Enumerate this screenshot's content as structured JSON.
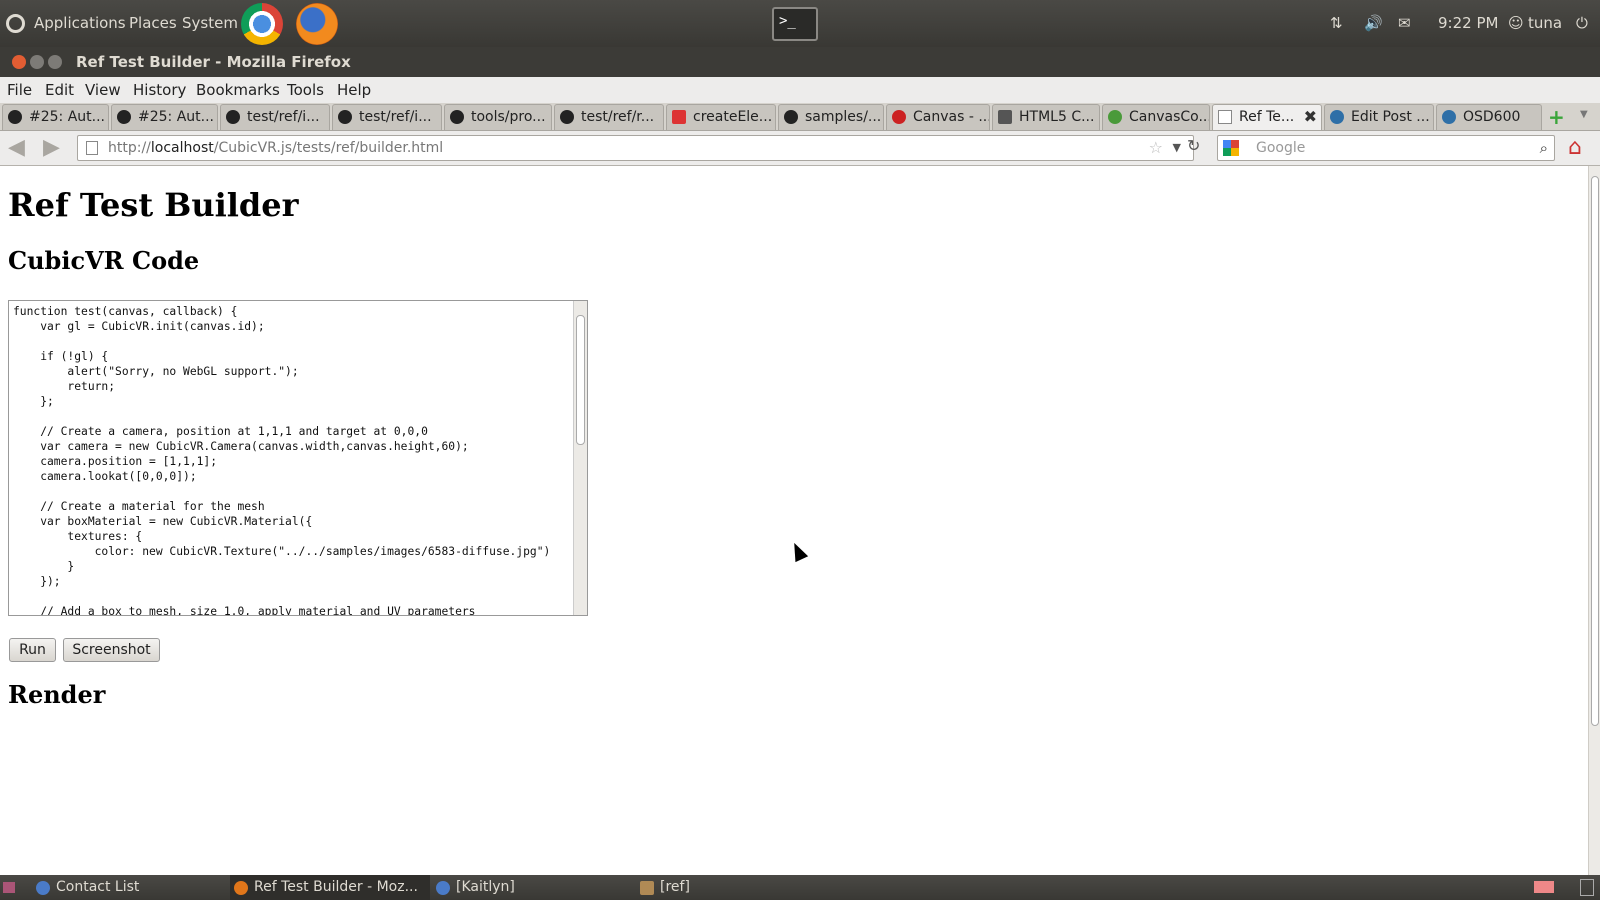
{
  "top_panel": {
    "menus": [
      "Applications",
      "Places",
      "System"
    ],
    "terminal_glyph": ">_",
    "clock": "9:22 PM",
    "user": "tuna"
  },
  "window": {
    "title": "Ref Test Builder - Mozilla Firefox"
  },
  "menubar": [
    "File",
    "Edit",
    "View",
    "History",
    "Bookmarks",
    "Tools",
    "Help"
  ],
  "tabs": [
    {
      "label": "#25: Aut..."
    },
    {
      "label": "#25: Aut..."
    },
    {
      "label": "test/ref/i..."
    },
    {
      "label": "test/ref/i..."
    },
    {
      "label": "tools/pro..."
    },
    {
      "label": "test/ref/r..."
    },
    {
      "label": "createEle..."
    },
    {
      "label": "samples/..."
    },
    {
      "label": "Canvas - ..."
    },
    {
      "label": "HTML5 C..."
    },
    {
      "label": "CanvasCo..."
    },
    {
      "label": "Ref Te...",
      "active": true
    },
    {
      "label": "Edit Post ..."
    },
    {
      "label": "OSD600"
    }
  ],
  "navbar": {
    "url_prefix": "http://",
    "url_host": "localhost",
    "url_path": "/CubicVR.js/tests/ref/builder.html",
    "search_placeholder": "Google"
  },
  "page": {
    "h1": "Ref Test Builder",
    "code_heading": "CubicVR Code",
    "code": "function test(canvas, callback) {\n    var gl = CubicVR.init(canvas.id);\n\n    if (!gl) {\n        alert(\"Sorry, no WebGL support.\");\n        return;\n    };\n\n    // Create a camera, position at 1,1,1 and target at 0,0,0\n    var camera = new CubicVR.Camera(canvas.width,canvas.height,60);\n    camera.position = [1,1,1];\n    camera.lookat([0,0,0]);\n\n    // Create a material for the mesh\n    var boxMaterial = new CubicVR.Material({\n        textures: {\n            color: new CubicVR.Texture(\"../../samples/images/6583-diffuse.jpg\")\n        }\n    });\n\n    // Add a box to mesh, size 1.0, apply material and UV parameters",
    "run_label": "Run",
    "screenshot_label": "Screenshot",
    "render_heading": "Render"
  },
  "taskbar": [
    {
      "label": "Contact List"
    },
    {
      "label": "Ref Test Builder - Moz...",
      "active": true
    },
    {
      "label": "[Kaitlyn]"
    },
    {
      "label": "[ref]"
    }
  ]
}
